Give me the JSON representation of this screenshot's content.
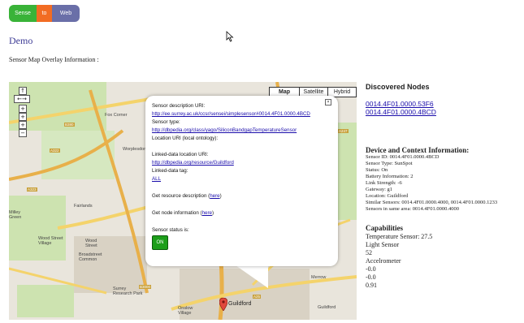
{
  "logo": {
    "parts": [
      "Sense",
      "to",
      "Web"
    ]
  },
  "page": {
    "title": "Demo",
    "subtitle": "Sensor Map Overlay Information :"
  },
  "map": {
    "types": [
      "Map",
      "Satellite",
      "Hybrid"
    ],
    "selected_type": "Map",
    "zoom_controls": [
      "↑",
      "←→",
      "+",
      "+",
      "+",
      "−"
    ],
    "places": [
      "Fox Corner",
      "Worplesdon",
      "Fairlands",
      "Wood Street Village",
      "Wood Street",
      "Broadstreet Common",
      "Surrey Research Park",
      "Onslow Village",
      "Guildford",
      "Merrow",
      "Send",
      "Milley Green"
    ],
    "roads": [
      "B380",
      "A322",
      "A323",
      "A247",
      "A3",
      "A25",
      "B3000"
    ],
    "popup": {
      "desc_label": "Sensor description URI:",
      "desc_url": "http://ee.surrey.ac.uk/ccsr/sensei/simplesensor#0014.4F01.0000.4BCD",
      "type_label": "Sensor type:",
      "type_url": "http://dbpedia.org/class/yago/SiliconBandgapTemperatureSensor",
      "loc_label": "Location URI (local ontology):",
      "linked_label": "Linked-data location URI:",
      "linked_url": "http://dbpedia.org/resource/Guildford",
      "tag_label": "Linked-data tag:",
      "tag_value": "ALL",
      "resource_prefix": "Get resource description (",
      "resource_link": "here",
      "resource_suffix": ")",
      "node_prefix": "Get node information (",
      "node_link": "here",
      "node_suffix": ")",
      "status_label": "Sensor status is:",
      "status_value": "ON",
      "close": "×"
    }
  },
  "discovered": {
    "title": "Discovered Nodes",
    "nodes": [
      "0014.4F01.0000.53F6",
      "0014.4F01.0000.4BCD"
    ]
  },
  "device": {
    "title": "Device and Context Information:",
    "lines": [
      "Sensor ID: 0014.4F01.0000.4BCD",
      "Sensor Type: SunSpot",
      "Status: On",
      "Battery Information: 2",
      "Link Strength: -6",
      "Gateway: g1",
      "Location: Guildford",
      "Similar Sensors: 0014.4F01.0000.4000, 0014.4F01.0000.1233",
      "Sensors in same area: 0014.4F01.0000.4000"
    ]
  },
  "capabilities": {
    "title": "Capabilities",
    "lines": [
      "Temperature Sensor: 27.5",
      "Light Sensor",
      "52",
      "Accelrometer",
      "-0.0",
      "-0.0",
      "0.91"
    ]
  }
}
